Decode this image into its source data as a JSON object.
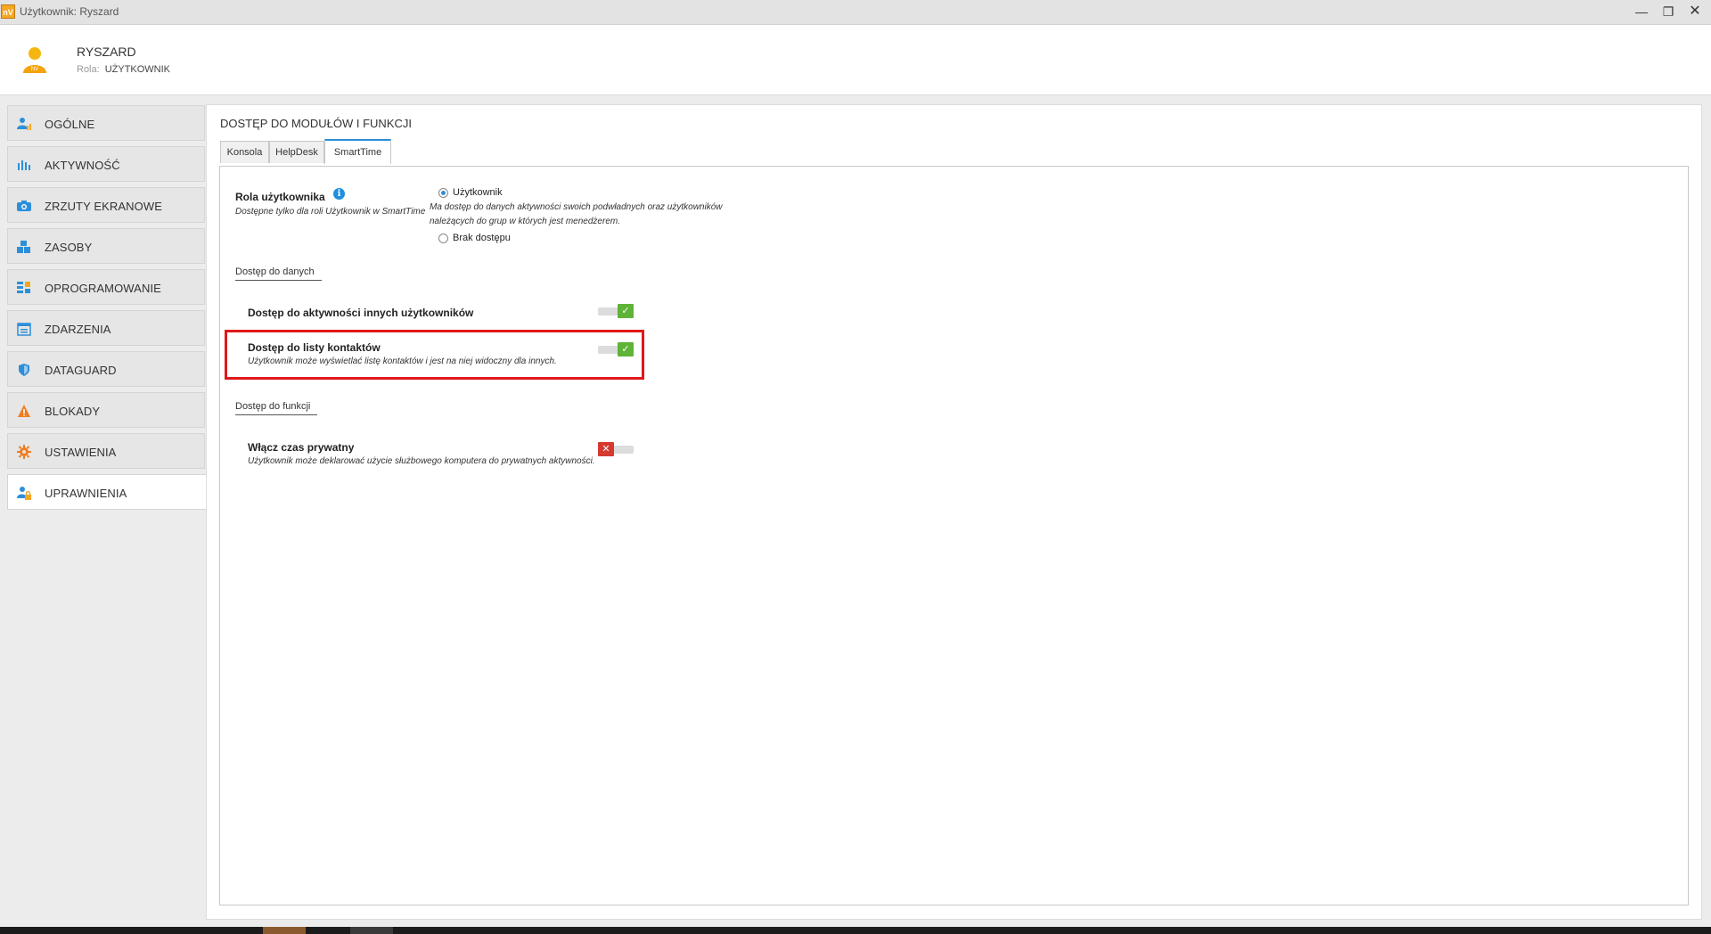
{
  "window": {
    "title": "Użytkownik: Ryszard",
    "app_icon_text": "nV"
  },
  "header": {
    "name": "RYSZARD",
    "role_label": "Rola:",
    "role_value": "UŻYTKOWNIK",
    "avatar_badge": "NV"
  },
  "sidebar": {
    "items": [
      {
        "label": "OGÓLNE",
        "icon": "user-chart-icon"
      },
      {
        "label": "AKTYWNOŚĆ",
        "icon": "bar-chart-icon"
      },
      {
        "label": "ZRZUTY EKRANOWE",
        "icon": "camera-icon"
      },
      {
        "label": "ZASOBY",
        "icon": "cubes-icon"
      },
      {
        "label": "OPROGRAMOWANIE",
        "icon": "software-grid-icon"
      },
      {
        "label": "ZDARZENIA",
        "icon": "calendar-icon"
      },
      {
        "label": "DATAGUARD",
        "icon": "shield-icon"
      },
      {
        "label": "BLOKADY",
        "icon": "warning-icon"
      },
      {
        "label": "USTAWIENIA",
        "icon": "gear-icon"
      },
      {
        "label": "UPRAWNIENIA",
        "icon": "user-lock-icon",
        "active": true
      }
    ]
  },
  "main": {
    "section_title": "DOSTĘP DO MODUŁÓW I FUNKCJI",
    "tabs": [
      {
        "label": "Konsola"
      },
      {
        "label": "HelpDesk"
      },
      {
        "label": "SmartTime",
        "active": true
      }
    ],
    "role": {
      "title": "Rola użytkownika",
      "description": "Dostępne tylko dla roli Użytkownik w SmartTime",
      "options": [
        {
          "label": "Użytkownik",
          "checked": true,
          "description": "Ma dostęp do danych aktywności swoich podwładnych oraz użytkowników należących do grup w których jest menedżerem."
        },
        {
          "label": "Brak dostępu",
          "checked": false
        }
      ]
    },
    "data_access": {
      "group_label": "Dostęp do danych",
      "items": [
        {
          "title": "Dostęp do aktywności innych użytkowników",
          "description": "",
          "enabled": true
        },
        {
          "title": "Dostęp do listy kontaktów",
          "description": "Użytkownik może wyświetlać listę kontaktów i jest na niej widoczny dla innych.",
          "enabled": true
        }
      ]
    },
    "function_access": {
      "group_label": "Dostęp do funkcji",
      "items": [
        {
          "title": "Włącz czas prywatny",
          "description": "Użytkownik może deklarować użycie służbowego komputera do prywatnych aktywności.",
          "enabled": false
        }
      ]
    }
  },
  "colors": {
    "accent": "#2d8fd8",
    "toggle_on": "#5fb337",
    "toggle_off": "#d43a2f",
    "highlight": "#e01818"
  }
}
